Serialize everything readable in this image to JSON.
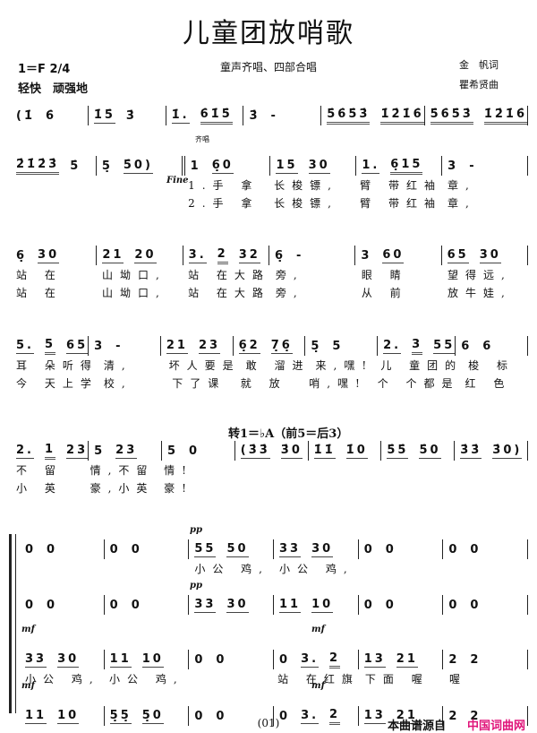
{
  "header": {
    "title": "儿童团放哨歌",
    "key": "1＝F  2/4",
    "tempo": "轻快　顽强地",
    "subtitle": "童声齐唱、四部合唱",
    "lyricist": "金　帆词",
    "composer": "瞿希贤曲"
  },
  "markings": {
    "unison": "齐唱",
    "fine": "Fine",
    "modulation": "转1＝♭A（前5＝后3）",
    "pp": "pp",
    "mf": "mf"
  },
  "systems": [
    {
      "measures": [
        [
          {
            "n": "(1̇",
            "b": 0
          },
          {
            "n": "6̇",
            "b": 0
          }
        ],
        [
          {
            "n": "1̇5̇",
            "b": 1
          },
          {
            "n": "3̇",
            "b": 0
          }
        ],
        [
          {
            "n": "1̇.",
            "b": 1
          },
          {
            "n": "6̇1̇5̇",
            "b": 2
          }
        ],
        [
          {
            "n": "3̇",
            "b": 0
          },
          {
            "n": "-",
            "b": 0
          }
        ],
        [
          {
            "n": "5̇6̇5̇3̇",
            "b": 2
          },
          {
            "n": "1̇2̇1̇6̇",
            "b": 2
          }
        ],
        [
          {
            "n": "5̇6̇5̇3̇",
            "b": 2
          },
          {
            "n": "1̇2̇1̇6̇",
            "b": 2
          }
        ]
      ],
      "lyrics": []
    },
    {
      "measures": [
        [
          {
            "n": "2̇1̇2̇3̇",
            "b": 2
          },
          {
            "n": "5̇",
            "b": 0
          }
        ],
        [
          {
            "n": "5̣",
            "b": 0
          },
          {
            "n": "5̇0)",
            "b": 1
          }
        ],
        [
          {
            "n": "1",
            "b": 0
          },
          {
            "n": "6̣0",
            "b": 1
          }
        ],
        [
          {
            "n": "15",
            "b": 1
          },
          {
            "n": "30",
            "b": 1
          }
        ],
        [
          {
            "n": "1.",
            "b": 1
          },
          {
            "n": "6̣15",
            "b": 2
          }
        ],
        [
          {
            "n": "3",
            "b": 0
          },
          {
            "n": "-",
            "b": 0
          }
        ]
      ],
      "lyrics": [
        [
          "",
          "",
          "1.手 拿",
          "长梭镖,",
          "臂 带红袖",
          "章,"
        ],
        [
          "",
          "",
          "2.手 拿",
          "长梭镖,",
          "臂 带红袖",
          "章,"
        ]
      ]
    },
    {
      "measures": [
        [
          {
            "n": "6̣",
            "b": 0
          },
          {
            "n": "30",
            "b": 1
          }
        ],
        [
          {
            "n": "21",
            "b": 1
          },
          {
            "n": "20",
            "b": 1
          }
        ],
        [
          {
            "n": "3.",
            "b": 1
          },
          {
            "n": "2",
            "b": 2
          },
          {
            "n": "32",
            "b": 1
          }
        ],
        [
          {
            "n": "6̣",
            "b": 0
          },
          {
            "n": "-",
            "b": 0
          }
        ],
        [
          {
            "n": "3",
            "b": 0
          },
          {
            "n": "60",
            "b": 1
          }
        ],
        [
          {
            "n": "65",
            "b": 1
          },
          {
            "n": "30",
            "b": 1
          }
        ]
      ],
      "lyrics": [
        [
          "站 在",
          "山坳口,",
          "站 在大路",
          "旁,",
          "眼 睛",
          "望得远,"
        ],
        [
          "站 在",
          "山坳口,",
          "站 在大路",
          "旁,",
          "从 前",
          "放牛娃,"
        ]
      ]
    },
    {
      "measures": [
        [
          {
            "n": "5.",
            "b": 1
          },
          {
            "n": "5",
            "b": 2
          },
          {
            "n": "65",
            "b": 1
          }
        ],
        [
          {
            "n": "3",
            "b": 0
          },
          {
            "n": "-",
            "b": 0
          }
        ],
        [
          {
            "n": "21",
            "b": 1
          },
          {
            "n": "23",
            "b": 1
          }
        ],
        [
          {
            "n": "6̣2",
            "b": 1
          },
          {
            "n": "7̣6̣",
            "b": 1
          }
        ],
        [
          {
            "n": "5̣",
            "b": 0
          },
          {
            "n": "5",
            "b": 0
          }
        ],
        [
          {
            "n": "2.",
            "b": 1
          },
          {
            "n": "3",
            "b": 2
          },
          {
            "n": "55",
            "b": 1
          }
        ],
        [
          {
            "n": "6",
            "b": 0
          },
          {
            "n": "6",
            "b": 0
          }
        ]
      ],
      "lyrics": [
        [
          "耳 朵听得",
          "清,",
          "坏人要是",
          "敢 溜进",
          "来,嘿!",
          "儿 童团的",
          "梭 标"
        ],
        [
          "今 天上学",
          "校,",
          "下了课",
          "就 放",
          "哨,嘿!",
          "个 个都是",
          "红 色"
        ]
      ]
    },
    {
      "measures": [
        [
          {
            "n": "2.",
            "b": 1
          },
          {
            "n": "1",
            "b": 2
          },
          {
            "n": "23",
            "b": 1
          }
        ],
        [
          {
            "n": "5",
            "b": 0
          },
          {
            "n": "23",
            "b": 1
          }
        ],
        [
          {
            "n": "5",
            "b": 0
          },
          {
            "n": "0",
            "b": 0
          }
        ],
        [
          {
            "n": "(3̇3̇",
            "b": 1
          },
          {
            "n": "3̇0",
            "b": 1
          }
        ],
        [
          {
            "n": "1̇1̇",
            "b": 1
          },
          {
            "n": "1̇0",
            "b": 1
          }
        ],
        [
          {
            "n": "5̇5̇",
            "b": 1
          },
          {
            "n": "5̇0",
            "b": 1
          }
        ],
        [
          {
            "n": "3̇3̇",
            "b": 1
          },
          {
            "n": "3̇0)",
            "b": 1
          }
        ]
      ],
      "lyrics": [
        [
          "不 留",
          "情,不留",
          "情!",
          "",
          "",
          "",
          ""
        ],
        [
          "小 英",
          "豪,小英",
          "豪!",
          "",
          "",
          "",
          ""
        ]
      ]
    },
    {
      "measures": [
        [
          {
            "n": "0",
            "b": 0
          },
          {
            "n": "0",
            "b": 0
          }
        ],
        [
          {
            "n": "0",
            "b": 0
          },
          {
            "n": "0",
            "b": 0
          }
        ],
        [
          {
            "n": "55",
            "b": 1
          },
          {
            "n": "50",
            "b": 1
          }
        ],
        [
          {
            "n": "33",
            "b": 1
          },
          {
            "n": "30",
            "b": 1
          }
        ],
        [
          {
            "n": "0",
            "b": 0
          },
          {
            "n": "0",
            "b": 0
          }
        ],
        [
          {
            "n": "0",
            "b": 0
          },
          {
            "n": "0",
            "b": 0
          }
        ]
      ],
      "lyrics": [
        [
          "",
          "",
          "小公 鸡,",
          "小公 鸡,",
          "",
          ""
        ]
      ]
    },
    {
      "measures": [
        [
          {
            "n": "0",
            "b": 0
          },
          {
            "n": "0",
            "b": 0
          }
        ],
        [
          {
            "n": "0",
            "b": 0
          },
          {
            "n": "0",
            "b": 0
          }
        ],
        [
          {
            "n": "33",
            "b": 1
          },
          {
            "n": "30",
            "b": 1
          }
        ],
        [
          {
            "n": "11",
            "b": 1
          },
          {
            "n": "10",
            "b": 1
          }
        ],
        [
          {
            "n": "0",
            "b": 0
          },
          {
            "n": "0",
            "b": 0
          }
        ],
        [
          {
            "n": "0",
            "b": 0
          },
          {
            "n": "0",
            "b": 0
          }
        ]
      ],
      "lyrics": []
    },
    {
      "measures": [
        [
          {
            "n": "33",
            "b": 1
          },
          {
            "n": "30",
            "b": 1
          }
        ],
        [
          {
            "n": "11",
            "b": 1
          },
          {
            "n": "10",
            "b": 1
          }
        ],
        [
          {
            "n": "0",
            "b": 0
          },
          {
            "n": "0",
            "b": 0
          }
        ],
        [
          {
            "n": "0",
            "b": 0
          },
          {
            "n": "3.",
            "b": 1
          },
          {
            "n": "2",
            "b": 2
          }
        ],
        [
          {
            "n": "13",
            "b": 1
          },
          {
            "n": "21",
            "b": 1
          }
        ],
        [
          {
            "n": "2",
            "b": 0
          },
          {
            "n": "2",
            "b": 0
          }
        ]
      ],
      "lyrics": [
        [
          "小公 鸡,",
          "小公 鸡,",
          "",
          "站 在红旗",
          "下面 喔",
          "喔"
        ]
      ]
    },
    {
      "measures": [
        [
          {
            "n": "11",
            "b": 1
          },
          {
            "n": "10",
            "b": 1
          }
        ],
        [
          {
            "n": "5̣5̣",
            "b": 1
          },
          {
            "n": "5̣0",
            "b": 1
          }
        ],
        [
          {
            "n": "0",
            "b": 0
          },
          {
            "n": "0",
            "b": 0
          }
        ],
        [
          {
            "n": "0",
            "b": 0
          },
          {
            "n": "3.",
            "b": 1
          },
          {
            "n": "2",
            "b": 2
          }
        ],
        [
          {
            "n": "13",
            "b": 1
          },
          {
            "n": "21",
            "b": 1
          }
        ],
        [
          {
            "n": "2",
            "b": 0
          },
          {
            "n": "2",
            "b": 0
          }
        ]
      ],
      "lyrics": []
    }
  ],
  "footer": {
    "page": "(01)",
    "source": "本曲谱源自",
    "site": "中国词曲网",
    "site_color": "#e0147a"
  }
}
